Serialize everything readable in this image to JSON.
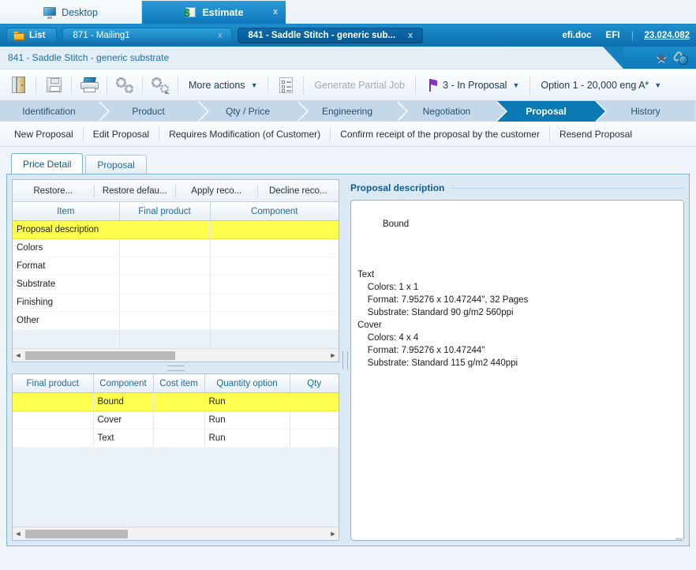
{
  "app_tabs": [
    {
      "label": "Desktop",
      "icon": "monitor-icon",
      "active": false,
      "closable": false
    },
    {
      "label": "Estimate",
      "icon": "money-icon",
      "active": true,
      "closable": true,
      "close_label": "x"
    }
  ],
  "doc_bar": {
    "list_button": "List",
    "list_icon": "folder-icon",
    "tabs": [
      {
        "label": "871 - Mailing1",
        "active": false,
        "close_label": "x"
      },
      {
        "label": "841 - Saddle Stitch - generic sub...",
        "active": true,
        "close_label": "x"
      }
    ],
    "user": "efi.doc",
    "company": "EFI",
    "version": "23.024.082"
  },
  "breadcrumb": "841 - Saddle Stitch - generic substrate",
  "breadcrumb_icons": [
    "favorite-star-icon",
    "attachment-globe-icon"
  ],
  "toolbar": {
    "exit_icon": "exit-door-icon",
    "save_icon": "save-floppy-icon",
    "print_icon": "printer-icon",
    "settings_icon": "gears-icon",
    "recalculate_icon": "gears-refresh-icon",
    "more_actions": "More actions",
    "more_actions_caret": "▼",
    "checklist_icon": "checklist-icon",
    "generate_partial_job": "Generate Partial Job",
    "status_icon": "purple-flag-icon",
    "status": "3 - In Proposal",
    "status_caret": "▼",
    "option": "Option 1 - 20,000 eng A*",
    "option_caret": "▼"
  },
  "steps": [
    {
      "label": "Identification",
      "active": false
    },
    {
      "label": "Product",
      "active": false
    },
    {
      "label": "Qty / Price",
      "active": false
    },
    {
      "label": "Engineering",
      "active": false
    },
    {
      "label": "Negotiation",
      "active": false
    },
    {
      "label": "Proposal",
      "active": true
    },
    {
      "label": "History",
      "active": false
    }
  ],
  "action_links": [
    "New Proposal",
    "Edit Proposal",
    "Requires Modification (of Customer)",
    "Confirm receipt of the proposal by the customer",
    "Resend Proposal"
  ],
  "content_tabs": [
    {
      "label": "Price Detail",
      "active": true
    },
    {
      "label": "Proposal",
      "active": false
    }
  ],
  "price_grid": {
    "buttons": [
      "Restore...",
      "Restore defau...",
      "Apply reco...",
      "Decline reco..."
    ],
    "columns": [
      "Item",
      "Final product",
      "Component"
    ],
    "rows": [
      {
        "cells": [
          "Proposal description",
          "",
          ""
        ],
        "selected": true
      },
      {
        "cells": [
          "Colors",
          "",
          ""
        ],
        "selected": false
      },
      {
        "cells": [
          "Format",
          "",
          ""
        ],
        "selected": false
      },
      {
        "cells": [
          "Substrate",
          "",
          ""
        ],
        "selected": false
      },
      {
        "cells": [
          "Finishing",
          "",
          ""
        ],
        "selected": false
      },
      {
        "cells": [
          "Other",
          "",
          ""
        ],
        "selected": false
      }
    ],
    "scroll_left_arrow": "◄",
    "scroll_right_arrow": "►"
  },
  "component_grid": {
    "columns": [
      "Final product",
      "Component",
      "Cost item",
      "Quantity option",
      "Qty"
    ],
    "rows": [
      {
        "cells": [
          "",
          "Bound",
          "",
          "Run",
          ""
        ],
        "selected": true
      },
      {
        "cells": [
          "",
          "Cover",
          "",
          "Run",
          ""
        ],
        "selected": false
      },
      {
        "cells": [
          "",
          "Text",
          "",
          "Run",
          ""
        ],
        "selected": false
      }
    ],
    "scroll_left_arrow": "◄",
    "scroll_right_arrow": "►"
  },
  "proposal_description": {
    "title": "Proposal description",
    "text": "Bound\n\n\n\nText\n    Colors: 1 x 1\n    Format: 7.95276 x 10.47244\", 32 Pages\n    Substrate: Standard 90 g/m2 560ppi\nCover\n    Colors: 4 x 4\n    Format: 7.95276 x 10.47244\"\n    Substrate: Standard 115 g/m2 440ppi"
  },
  "colors": {
    "accent": "#0b7ab5",
    "header_blue": "#1079bd",
    "selection_yellow": "#ffff4d",
    "panel_blue": "#dbe9f5",
    "step_inactive": "#c3d9ea"
  }
}
